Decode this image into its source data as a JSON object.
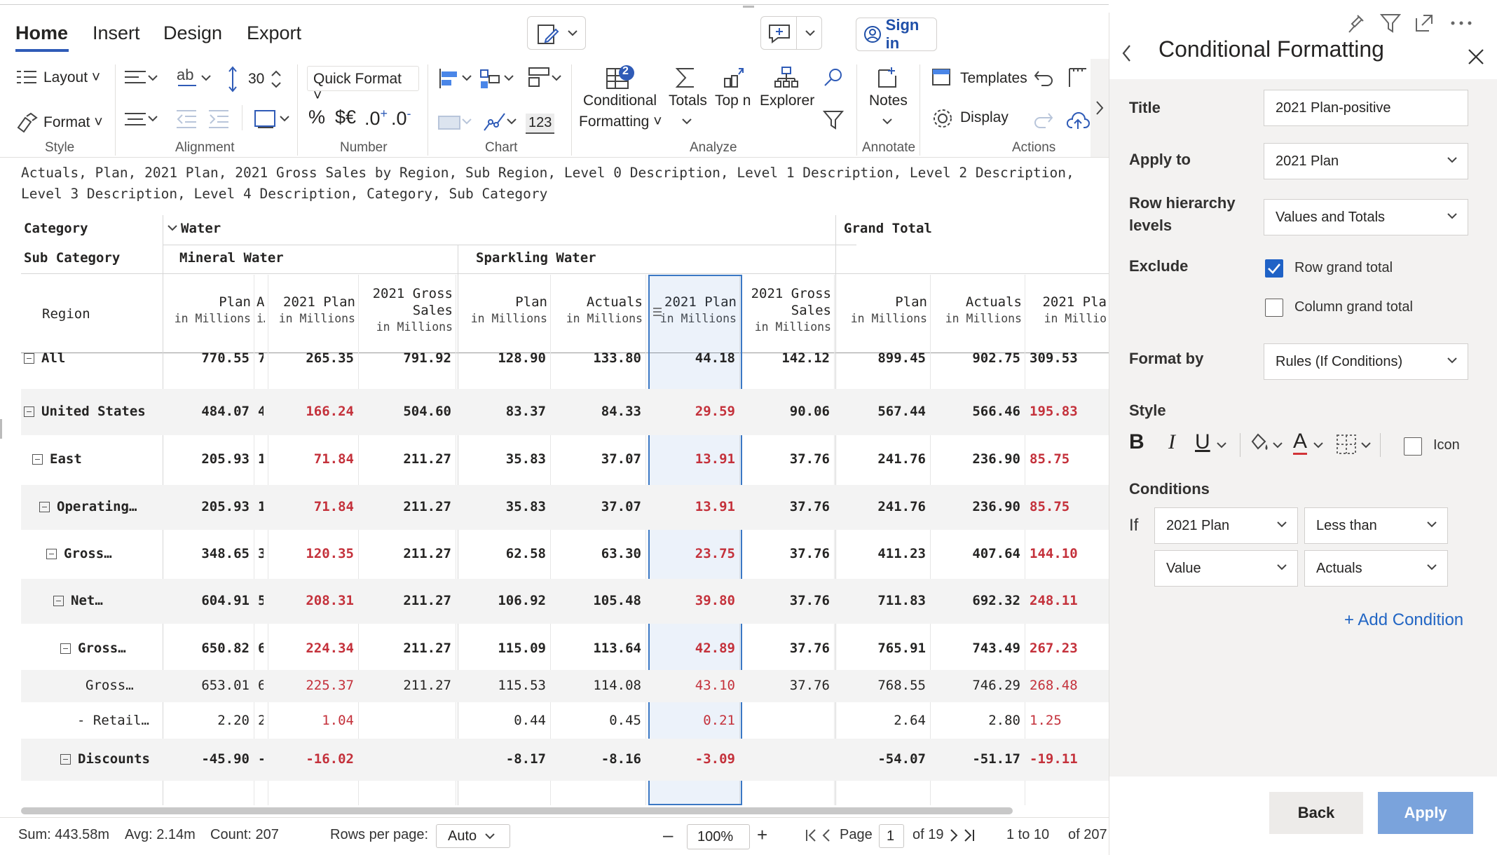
{
  "tabs": [
    "Home",
    "Insert",
    "Design",
    "Export"
  ],
  "sign_in": "Sign in",
  "ribbon": {
    "layout": "Layout",
    "format": "Format",
    "row_height": "30",
    "quick_format": "Quick Format",
    "pct": "%",
    "currency": "$€",
    "inc_dec": ".0",
    "dec_dec": ".0",
    "num_123": "123",
    "conditional": "Conditional",
    "formatting": "Formatting",
    "totals": "Totals",
    "topn": "Top n",
    "explorer": "Explorer",
    "notes": "Notes",
    "templates": "Templates",
    "display": "Display",
    "cf_badge": "2",
    "groups": {
      "style": "Style",
      "alignment": "Alignment",
      "number": "Number",
      "chart": "Chart",
      "analyze": "Analyze",
      "annotate": "Annotate",
      "actions": "Actions"
    }
  },
  "description": "Actuals, Plan, 2021 Plan, 2021 Gross Sales by Region, Sub Region, Level 0 Description, Level 1 Description, Level 2 Description, Level 3 Description, Level 4 Description, Category, Sub Category",
  "grid": {
    "category_label": "Category",
    "subcategory_label": "Sub Category",
    "region_label": "Region",
    "water": "Water",
    "grand_total": "Grand Total",
    "mineral": "Mineral Water",
    "sparkling": "Sparkling Water",
    "columns": [
      {
        "name": "Plan",
        "unit": "in Millions"
      },
      {
        "name": "A…",
        "unit": "i…"
      },
      {
        "name": "2021 Plan",
        "unit": "in Millions"
      },
      {
        "name": "2021 Gross Sales",
        "unit": "in Millions"
      },
      {
        "name": "Plan",
        "unit": "in Millions"
      },
      {
        "name": "Actuals",
        "unit": "in Millions"
      },
      {
        "name": "2021 Plan",
        "unit": "in Millions"
      },
      {
        "name": "2021 Gross Sales",
        "unit": "in Millions"
      },
      {
        "name": "Plan",
        "unit": "in Millions"
      },
      {
        "name": "Actuals",
        "unit": "in Millions"
      },
      {
        "name": "2021 Pla",
        "unit": "in Millio"
      }
    ],
    "rows": [
      {
        "label": "All",
        "values": [
          "770.55",
          "7",
          "265.35",
          "791.92",
          "128.90",
          "133.80",
          "44.18",
          "142.12",
          "899.45",
          "902.75",
          "309.53"
        ]
      },
      {
        "label": "United States",
        "values": [
          "484.07",
          "4",
          "166.24",
          "504.60",
          "83.37",
          "84.33",
          "29.59",
          "90.06",
          "567.44",
          "566.46",
          "195.83"
        ]
      },
      {
        "label": "East",
        "values": [
          "205.93",
          "1",
          "71.84",
          "211.27",
          "35.83",
          "37.07",
          "13.91",
          "37.76",
          "241.76",
          "236.90",
          "85.75"
        ]
      },
      {
        "label": "Operating…",
        "values": [
          "205.93",
          "1",
          "71.84",
          "211.27",
          "35.83",
          "37.07",
          "13.91",
          "37.76",
          "241.76",
          "236.90",
          "85.75"
        ]
      },
      {
        "label": "Gross…",
        "values": [
          "348.65",
          "3",
          "120.35",
          "211.27",
          "62.58",
          "63.30",
          "23.75",
          "37.76",
          "411.23",
          "407.64",
          "144.10"
        ]
      },
      {
        "label": "Net…",
        "values": [
          "604.91",
          "5",
          "208.31",
          "211.27",
          "106.92",
          "105.48",
          "39.80",
          "37.76",
          "711.83",
          "692.32",
          "248.11"
        ]
      },
      {
        "label": "Gross…",
        "values": [
          "650.82",
          "6",
          "224.34",
          "211.27",
          "115.09",
          "113.64",
          "42.89",
          "37.76",
          "765.91",
          "743.49",
          "267.23"
        ]
      },
      {
        "label": "Gross…",
        "values": [
          "653.01",
          "6",
          "225.37",
          "211.27",
          "115.53",
          "114.08",
          "43.10",
          "37.76",
          "768.55",
          "746.29",
          "268.48"
        ]
      },
      {
        "label": "Retail…",
        "values": [
          "2.20",
          "2",
          "1.04",
          "",
          "0.44",
          "0.45",
          "0.21",
          "",
          "2.64",
          "2.80",
          "1.25"
        ]
      },
      {
        "label": "Discounts",
        "values": [
          "-45.90",
          "-",
          "-16.02",
          "",
          "-8.17",
          "-8.16",
          "-3.09",
          "",
          "-54.07",
          "-51.17",
          "-19.11"
        ]
      }
    ]
  },
  "status": {
    "sum": "Sum: 443.58m",
    "avg": "Avg: 2.14m",
    "count": "Count: 207",
    "rows_per_page": "Rows per page:",
    "rows_value": "Auto",
    "zoom": "100%",
    "page_label": "Page",
    "page_value": "1",
    "of_pages": "of 19",
    "range": "1  to 10",
    "of_total": "of 207"
  },
  "panel": {
    "title": "Conditional Formatting",
    "title_label": "Title",
    "title_value": "2021 Plan-positive",
    "apply_to_label": "Apply to",
    "apply_to_value": "2021 Plan",
    "row_levels_label_1": "Row hierarchy",
    "row_levels_label_2": "levels",
    "row_levels_value": "Values and Totals",
    "exclude_label": "Exclude",
    "row_grand_total": "Row grand total",
    "column_grand_total": "Column grand total",
    "row_grand_total_checked": true,
    "column_grand_total_checked": false,
    "format_by_label": "Format by",
    "format_by_value": "Rules (If Conditions)",
    "style_label": "Style",
    "bold": "B",
    "italic": "I",
    "underline": "U",
    "font_color": "A",
    "icon_label": "Icon",
    "conditions_label": "Conditions",
    "if_label": "If",
    "cond_field": "2021 Plan",
    "cond_operator": "Less than",
    "cond_type": "Value",
    "cond_value": "Actuals",
    "add_condition": "+ Add Condition",
    "back": "Back",
    "apply": "Apply"
  },
  "colors": {
    "accent": "#2f5bb7",
    "negative": "#c4313b",
    "apply_button": "#7aa3dc",
    "selection": "#3b78c4"
  }
}
